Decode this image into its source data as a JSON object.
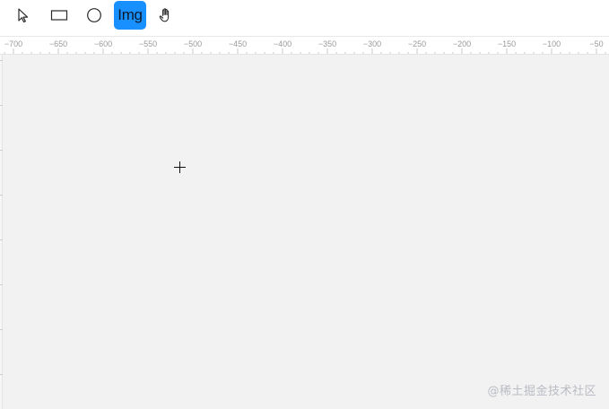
{
  "toolbar": {
    "tools": [
      {
        "id": "select",
        "icon": "pointer-arrow-icon",
        "label": ""
      },
      {
        "id": "rect",
        "icon": "rectangle-icon",
        "label": ""
      },
      {
        "id": "circle",
        "icon": "circle-icon",
        "label": ""
      },
      {
        "id": "image",
        "icon": "image-tool",
        "label": "Img",
        "active": true
      },
      {
        "id": "pan",
        "icon": "hand-icon",
        "label": ""
      }
    ],
    "active_color": "#1890ff"
  },
  "ruler": {
    "labels": [
      "-700",
      "-650",
      "-600",
      "-550",
      "-500",
      "-450",
      "-400",
      "-350",
      "-300",
      "-250",
      "-200",
      "-150",
      "-100",
      "-50"
    ]
  },
  "canvas": {
    "background": "#f2f2f2",
    "cursor": "crosshair-icon"
  },
  "watermark": {
    "text": "@稀土掘金技术社区"
  }
}
